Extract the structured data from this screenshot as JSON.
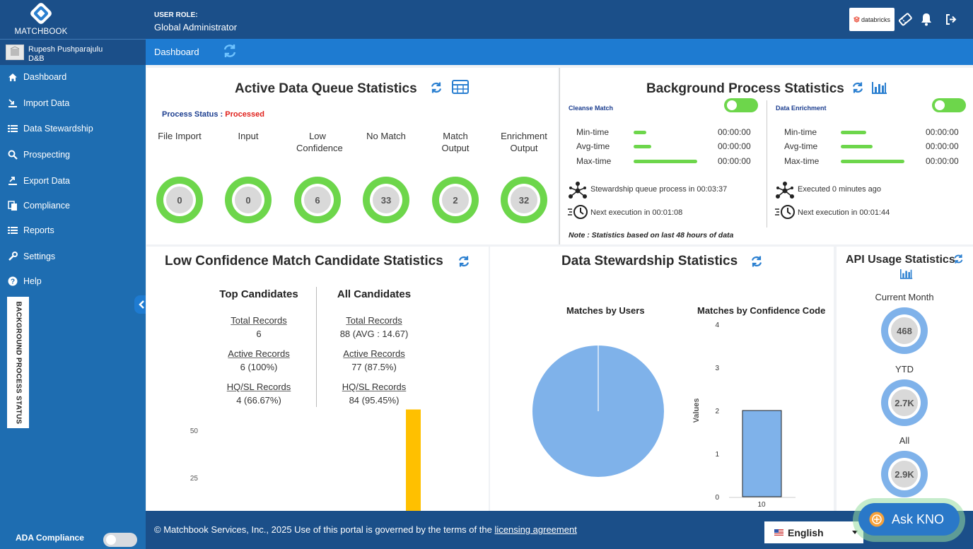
{
  "brand": {
    "logo_text": "MATCHBOOK",
    "partner_logo": "databricks"
  },
  "header": {
    "role_label": "USER ROLE:",
    "role_value": "Global Administrator"
  },
  "user": {
    "name": "Rupesh Pushparajulu",
    "org": "D&B"
  },
  "breadcrumb": {
    "current": "Dashboard"
  },
  "sidebar": {
    "items": [
      {
        "label": "Dashboard",
        "icon": "home-icon"
      },
      {
        "label": "Import Data",
        "icon": "import-icon"
      },
      {
        "label": "Data Stewardship",
        "icon": "list-icon"
      },
      {
        "label": "Prospecting",
        "icon": "search-icon"
      },
      {
        "label": "Export Data",
        "icon": "export-icon"
      },
      {
        "label": "Compliance",
        "icon": "documents-icon"
      },
      {
        "label": "Reports",
        "icon": "list-icon"
      },
      {
        "label": "Settings",
        "icon": "wrench-icon"
      },
      {
        "label": "Help",
        "icon": "help-icon"
      }
    ],
    "bg_process_tab": "BACKGROUND PROCESS STATUS",
    "ada_label": "ADA Compliance"
  },
  "queue": {
    "title": "Active Data Queue Statistics",
    "process_status_label": "Process Status : ",
    "process_status_value": "Processed",
    "items": [
      {
        "label": "File Import",
        "value": "0"
      },
      {
        "label": "Input",
        "value": "0"
      },
      {
        "label": "Low Confidence",
        "value": "6"
      },
      {
        "label": "No Match",
        "value": "33"
      },
      {
        "label": "Match Output",
        "value": "2"
      },
      {
        "label": "Enrichment Output",
        "value": "32"
      }
    ]
  },
  "background": {
    "title": "Background Process Statistics",
    "cleanse": {
      "label": "Cleanse Match",
      "rows": [
        {
          "label": "Min-time",
          "value": "00:00:00",
          "fill": 0.2
        },
        {
          "label": "Avg-time",
          "value": "00:00:00",
          "fill": 0.28
        },
        {
          "label": "Max-time",
          "value": "00:00:00",
          "fill": 1.0
        }
      ],
      "status": "Stewardship queue process in 00:03:37",
      "next": "Next execution in 00:01:08"
    },
    "enrichment": {
      "label": "Data Enrichment",
      "rows": [
        {
          "label": "Min-time",
          "value": "00:00:00",
          "fill": 0.4
        },
        {
          "label": "Avg-time",
          "value": "00:00:00",
          "fill": 0.5
        },
        {
          "label": "Max-time",
          "value": "00:00:00",
          "fill": 1.0
        }
      ],
      "status": "Executed 0 minutes ago",
      "next": "Next execution in 00:01:44"
    },
    "note": "Note : Statistics based on last 48 hours of data"
  },
  "low_conf": {
    "title": "Low Confidence Match Candidate Statistics",
    "top": {
      "heading": "Top Candidates",
      "rows": [
        {
          "label": "Total Records",
          "value": "6"
        },
        {
          "label": "Active Records",
          "value": "6 (100%)"
        },
        {
          "label": "HQ/SL Records",
          "value": "4 (66.67%)"
        }
      ]
    },
    "all": {
      "heading": "All Candidates",
      "rows": [
        {
          "label": "Total Records",
          "value": "88 (AVG : 14.67)"
        },
        {
          "label": "Active Records",
          "value": "77 (87.5%)"
        },
        {
          "label": "HQ/SL Records",
          "value": "84 (95.45%)"
        }
      ]
    }
  },
  "stewardship": {
    "title": "Data Stewardship Statistics",
    "pie_title": "Matches by Users",
    "bar_title": "Matches by Confidence Code"
  },
  "api": {
    "title": "API Usage Statistics",
    "items": [
      {
        "label": "Current Month",
        "value": "468"
      },
      {
        "label": "YTD",
        "value": "2.7K"
      },
      {
        "label": "All",
        "value": "2.9K"
      }
    ]
  },
  "footer": {
    "text": "© Matchbook Services, Inc., 2025 Use of this portal is governed by the terms of the",
    "link": "licensing agreement",
    "language": "English"
  },
  "ask_button": "Ask KNO",
  "colors": {
    "brand_dark": "#1b4f89",
    "sidebar": "#1e6db1",
    "accent_green": "#6dd64b",
    "accent_blue": "#7fb2ea",
    "bar_yellow": "#ffc000",
    "status_red": "#e0201b"
  },
  "chart_data": [
    {
      "type": "bar",
      "title": "",
      "y_ticks": [
        25,
        50
      ],
      "series": [
        {
          "values": [
            5
          ]
        },
        {
          "values": [
            61
          ]
        }
      ]
    },
    {
      "type": "pie",
      "title": "Matches by Users",
      "values": [
        100
      ]
    },
    {
      "type": "bar",
      "title": "Matches by Confidence Code",
      "ylabel": "Values",
      "categories": [
        "10"
      ],
      "values": [
        2
      ],
      "ylim": [
        0,
        4
      ],
      "y_ticks": [
        0,
        1,
        2,
        3,
        4
      ]
    }
  ]
}
